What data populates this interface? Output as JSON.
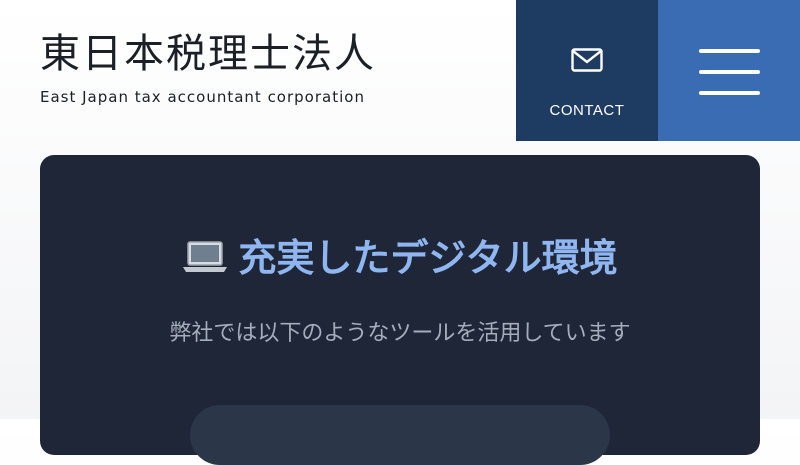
{
  "header": {
    "logo_title": "東日本税理士法人",
    "logo_subtitle": "East Japan tax accountant corporation",
    "contact_label": "CONTACT",
    "contact_icon": "mail-icon",
    "menu_icon": "hamburger-menu-icon"
  },
  "section": {
    "icon": "laptop-icon",
    "title": "充実したデジタル環境",
    "subtitle": "弊社では以下のようなツールを活用しています"
  },
  "colors": {
    "contact_bg": "#1e3b62",
    "menu_bg": "#3a6cb3",
    "card_bg": "#1f2638",
    "title_text": "#8fb6f0",
    "subtitle_text": "#a6adba"
  }
}
